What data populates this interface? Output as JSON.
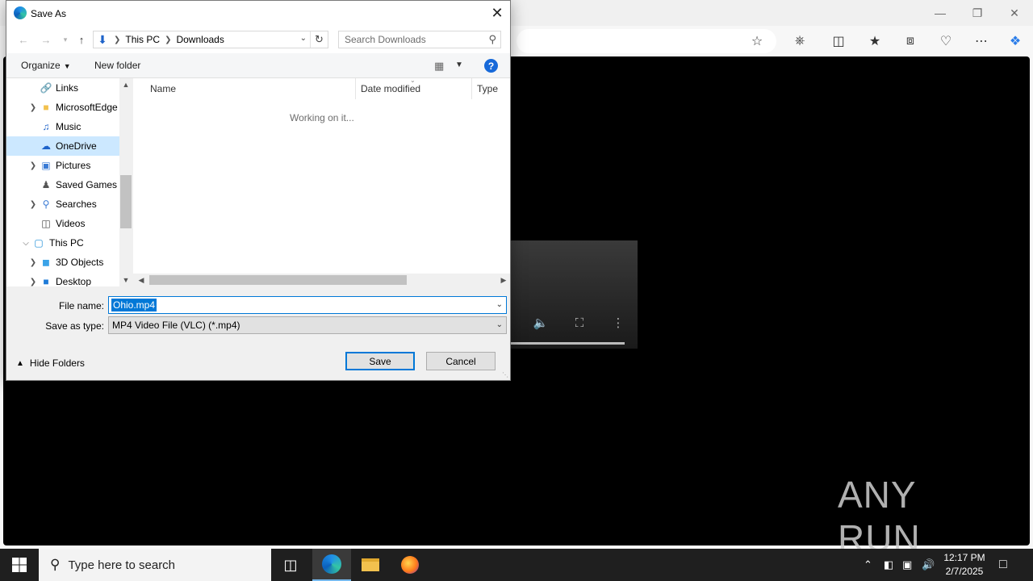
{
  "dialog": {
    "title": "Save As",
    "path": [
      "This PC",
      "Downloads"
    ],
    "search_placeholder": "Search Downloads",
    "organize": "Organize",
    "new_folder": "New folder",
    "tree": [
      {
        "label": "Links",
        "icon": "links-icon",
        "expandable": false,
        "expanded": false,
        "level": 1,
        "selected": false
      },
      {
        "label": "MicrosoftEdge",
        "icon": "folder-icon",
        "expandable": true,
        "expanded": false,
        "level": 1,
        "selected": false
      },
      {
        "label": "Music",
        "icon": "music-icon",
        "expandable": false,
        "expanded": false,
        "level": 1,
        "selected": false
      },
      {
        "label": "OneDrive",
        "icon": "onedrive-icon",
        "expandable": false,
        "expanded": false,
        "level": 1,
        "selected": true
      },
      {
        "label": "Pictures",
        "icon": "pictures-icon",
        "expandable": true,
        "expanded": false,
        "level": 1,
        "selected": false
      },
      {
        "label": "Saved Games",
        "icon": "saved-games-icon",
        "expandable": false,
        "expanded": false,
        "level": 1,
        "selected": false
      },
      {
        "label": "Searches",
        "icon": "searches-icon",
        "expandable": true,
        "expanded": false,
        "level": 1,
        "selected": false
      },
      {
        "label": "Videos",
        "icon": "videos-icon",
        "expandable": false,
        "expanded": false,
        "level": 1,
        "selected": false
      },
      {
        "label": "This PC",
        "icon": "this-pc-icon",
        "expandable": true,
        "expanded": true,
        "level": 0,
        "selected": false
      },
      {
        "label": "3D Objects",
        "icon": "3d-objects-icon",
        "expandable": true,
        "expanded": false,
        "level": 1,
        "selected": false
      },
      {
        "label": "Desktop",
        "icon": "desktop-icon",
        "expandable": true,
        "expanded": false,
        "level": 1,
        "selected": false
      }
    ],
    "columns": [
      "Name",
      "Date modified",
      "Type"
    ],
    "status": "Working on it...",
    "file_name_label": "File name:",
    "file_name": "Ohio.mp4",
    "save_type_label": "Save as type:",
    "save_type": "MP4 Video File (VLC) (*.mp4)",
    "hide_folders": "Hide Folders",
    "save": "Save",
    "cancel": "Cancel"
  },
  "taskbar": {
    "search_placeholder": "Type here to search",
    "time": "12:17 PM",
    "date": "2/7/2025"
  },
  "watermark": "ANY RUN",
  "colors": {
    "accent": "#0078d7",
    "selection": "#cce8ff",
    "help": "#1769d9"
  }
}
